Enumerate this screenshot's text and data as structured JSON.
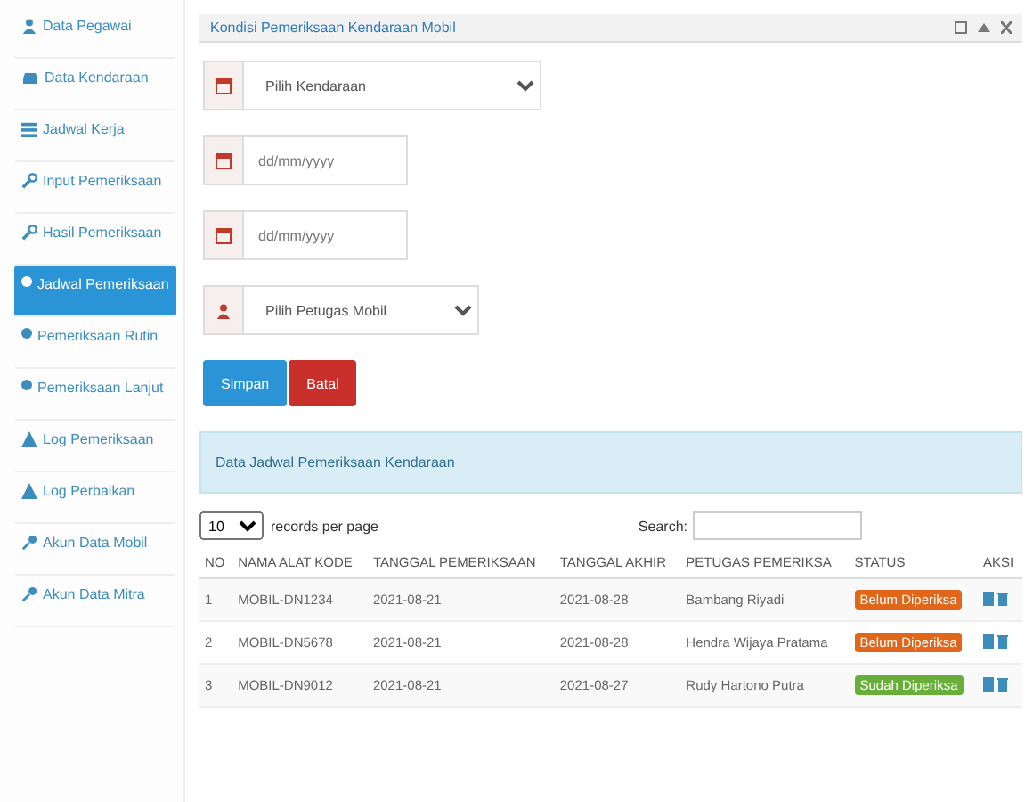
{
  "sidebar": {
    "items": [
      {
        "label": "Data Pegawai",
        "selected": false
      },
      {
        "label": "Data Kendaraan",
        "selected": false
      },
      {
        "label": "Jadwal Kerja",
        "selected": false
      },
      {
        "label": "Input Pemeriksaan",
        "selected": false
      },
      {
        "label": "Hasil Pemeriksaan",
        "selected": false
      },
      {
        "label": "Jadwal Pemeriksaan",
        "selected": true
      },
      {
        "label": "Pemeriksaan Rutin",
        "selected": false
      },
      {
        "label": "Pemeriksaan Lanjut",
        "selected": false
      },
      {
        "label": "Log Pemeriksaan",
        "selected": false
      },
      {
        "label": "Log Perbaikan",
        "selected": false
      },
      {
        "label": "Akun Data Mobil",
        "selected": false
      },
      {
        "label": "Akun Data Mitra",
        "selected": false
      }
    ]
  },
  "panel": {
    "title": "Kondisi Pemeriksaan Kendaraan Mobil",
    "form": [
      {
        "kind": "select",
        "placeholder": "Pilih Kendaraan"
      },
      {
        "kind": "date",
        "placeholder": "dd/mm/yyyy"
      },
      {
        "kind": "date",
        "placeholder": "dd/mm/yyyy"
      },
      {
        "kind": "select",
        "placeholder": "Pilih Petugas Mobil"
      }
    ],
    "buttons": [
      {
        "label": "Simpan",
        "kind": "primary"
      },
      {
        "label": "Batal",
        "kind": "danger"
      }
    ]
  },
  "info": "Data Jadwal Pemeriksaan Kendaraan",
  "table": {
    "page_size": "10",
    "page_size_label": "records per page",
    "search_label": "Search:",
    "columns": [
      "NO",
      "NAMA ALAT KODE",
      "TANGGAL PEMERIKSAAN",
      "TANGGAL AKHIR",
      "PETUGAS PEMERIKSA",
      "STATUS",
      "AKSI"
    ],
    "rows": [
      {
        "cells": [
          "1",
          "MOBIL-DN1234",
          "2021-08-21",
          "2021-08-28",
          "Bambang Riyadi"
        ],
        "status": "Belum Diperiksa",
        "kind": "pending"
      },
      {
        "cells": [
          "2",
          "MOBIL-DN5678",
          "2021-08-21",
          "2021-08-28",
          "Hendra Wijaya Pratama"
        ],
        "status": "Belum Diperiksa",
        "kind": "pending"
      },
      {
        "cells": [
          "3",
          "MOBIL-DN9012",
          "2021-08-21",
          "2021-08-27",
          "Rudy Hartono Putra"
        ],
        "status": "Sudah Diperiksa",
        "kind": "done"
      }
    ]
  }
}
